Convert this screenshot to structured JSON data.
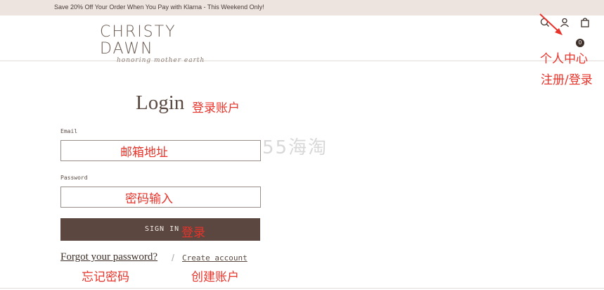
{
  "promo": {
    "text": "Save 20% Off Your Order When You Pay with Klarna - This Weekend Only!"
  },
  "header": {
    "logo_name": "CHRISTY DAWN",
    "logo_tagline": "honoring mother earth",
    "icons": [
      "search-icon",
      "user-icon",
      "bag-icon"
    ],
    "cart_count": "0"
  },
  "login": {
    "title": "Login",
    "email_label": "Email",
    "email_value": "",
    "password_label": "Password",
    "password_value": "",
    "sign_in_label": "SIGN IN",
    "forgot_label": "Forgot your password?",
    "separator": "/",
    "create_label": "Create account"
  },
  "annotations": {
    "account": "个人中心",
    "register_login": "注册/登录",
    "login_account": "登录账户",
    "email_address": "邮箱地址",
    "password_input": "密码输入",
    "sign_in": "登录",
    "forgot_password": "忘记密码",
    "create_account": "创建账户",
    "watermark": "55海淘"
  },
  "colors": {
    "annotation": "#e8332a",
    "button": "#5b4740",
    "promo_bar": "#ede4e0"
  }
}
